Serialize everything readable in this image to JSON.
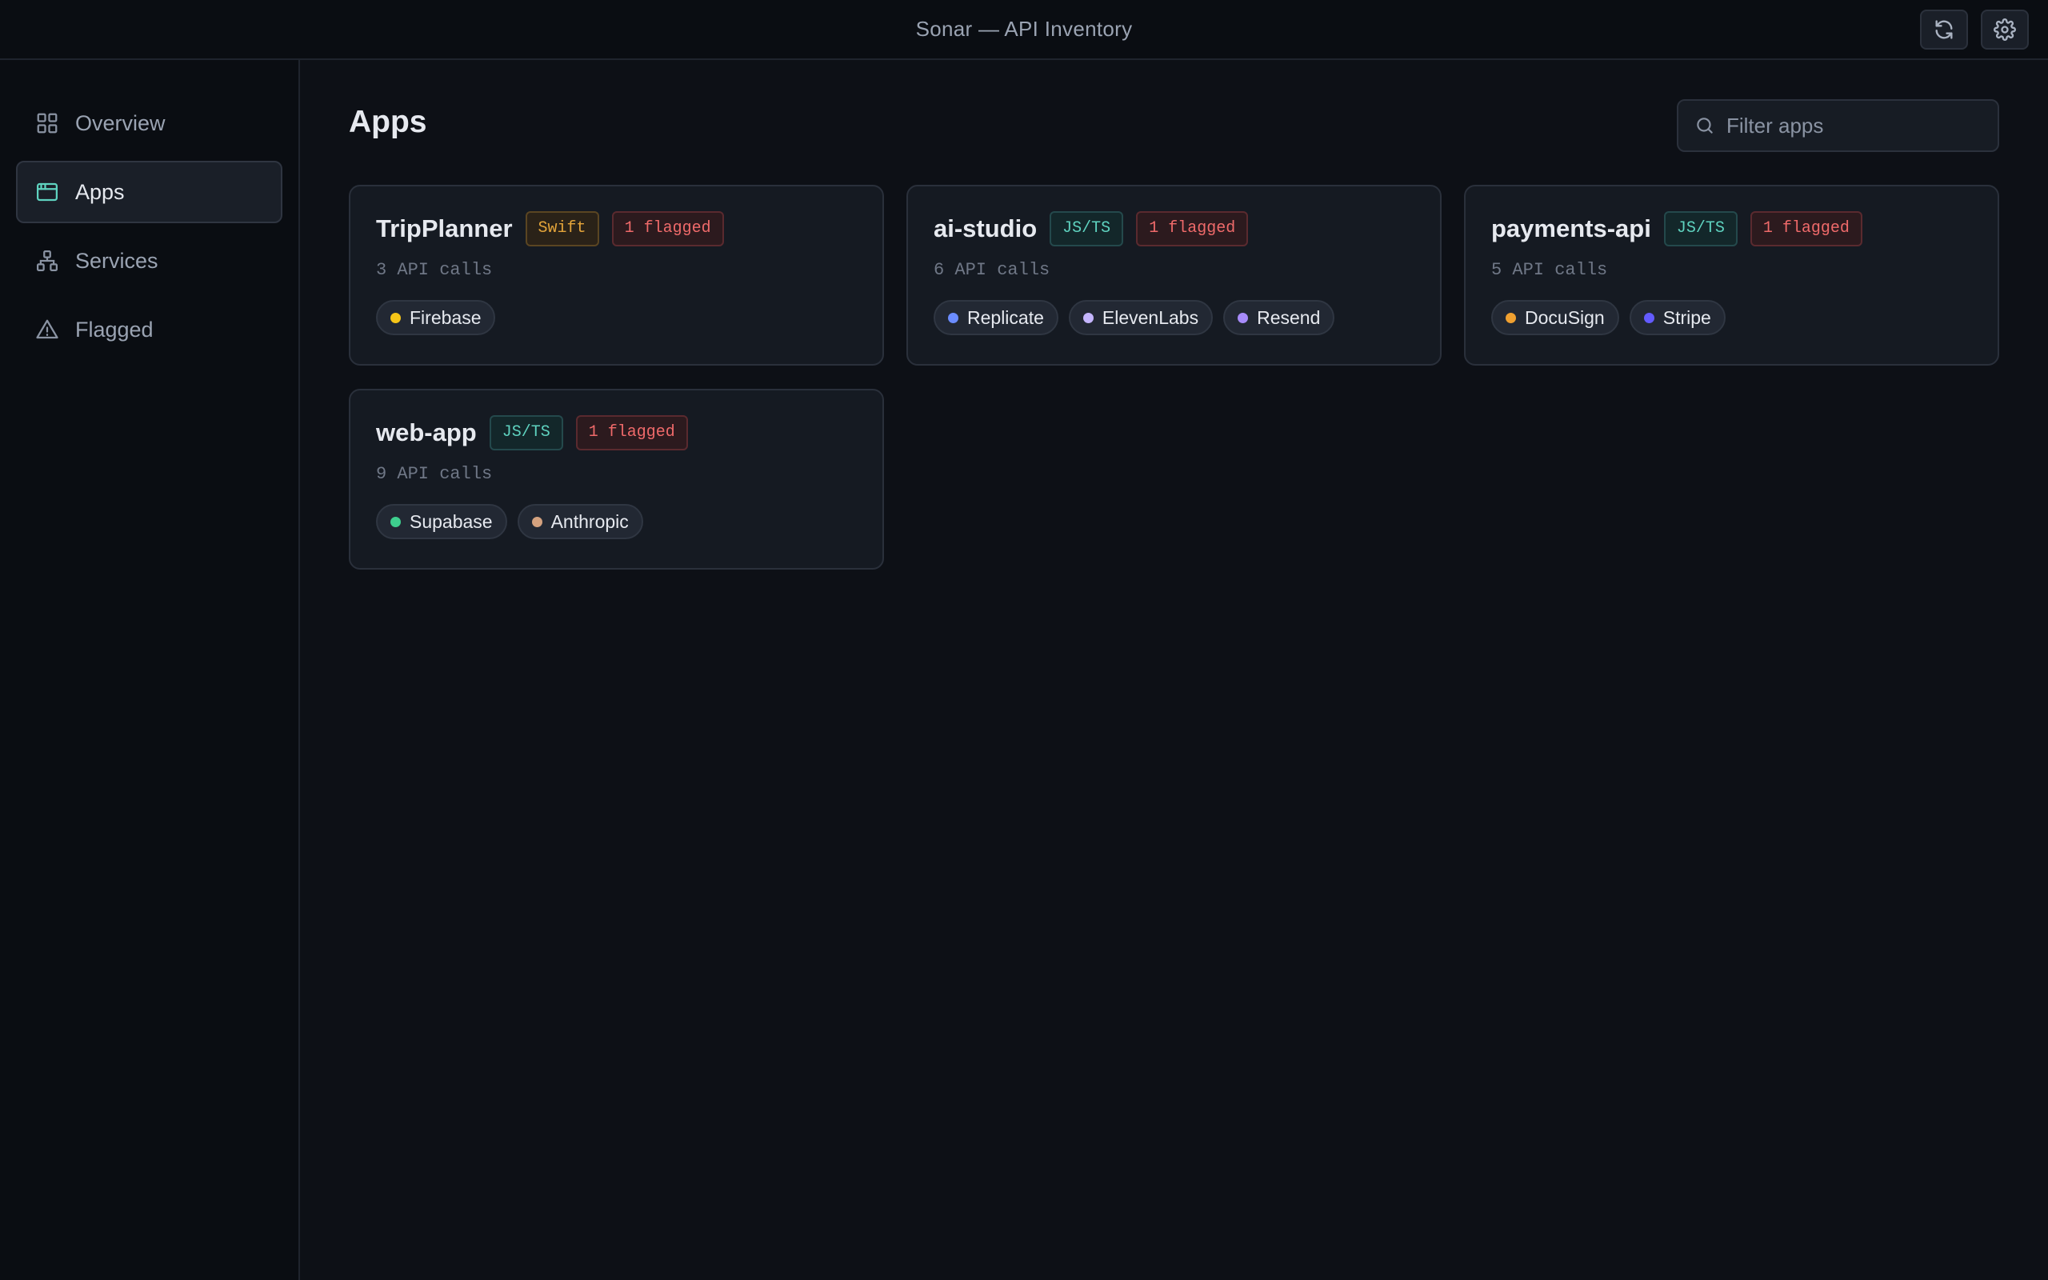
{
  "window": {
    "title": "Sonar — API Inventory",
    "refresh_icon": "refresh-icon",
    "settings_icon": "gear-icon"
  },
  "sidebar": {
    "items": [
      {
        "label": "Overview",
        "icon": "grid-icon",
        "active": false
      },
      {
        "label": "Apps",
        "icon": "app-window-icon",
        "active": true
      },
      {
        "label": "Services",
        "icon": "network-icon",
        "active": false
      },
      {
        "label": "Flagged",
        "icon": "warning-icon",
        "active": false
      }
    ]
  },
  "main": {
    "title": "Apps",
    "filter_placeholder": "Filter apps",
    "apps": [
      {
        "name": "TripPlanner",
        "lang": "Swift",
        "flagged": "1 flagged",
        "calls": "3 API calls",
        "services": [
          {
            "name": "Firebase",
            "color": "#f5c518"
          }
        ]
      },
      {
        "name": "ai-studio",
        "lang": "JS/TS",
        "flagged": "1 flagged",
        "calls": "6 API calls",
        "services": [
          {
            "name": "Replicate",
            "color": "#6b8cff"
          },
          {
            "name": "ElevenLabs",
            "color": "#c4b5fd"
          },
          {
            "name": "Resend",
            "color": "#a78bfa"
          }
        ]
      },
      {
        "name": "payments-api",
        "lang": "JS/TS",
        "flagged": "1 flagged",
        "calls": "5 API calls",
        "services": [
          {
            "name": "DocuSign",
            "color": "#f0a030"
          },
          {
            "name": "Stripe",
            "color": "#635bff"
          }
        ]
      },
      {
        "name": "web-app",
        "lang": "JS/TS",
        "flagged": "1 flagged",
        "calls": "9 API calls",
        "services": [
          {
            "name": "Supabase",
            "color": "#3ecf8e"
          },
          {
            "name": "Anthropic",
            "color": "#d4a27f"
          }
        ]
      }
    ]
  },
  "colors": {
    "accent": "#5fd3c0",
    "flag": "#ef6a6a",
    "swift": "#e3a43a",
    "background": "#0d1016"
  }
}
